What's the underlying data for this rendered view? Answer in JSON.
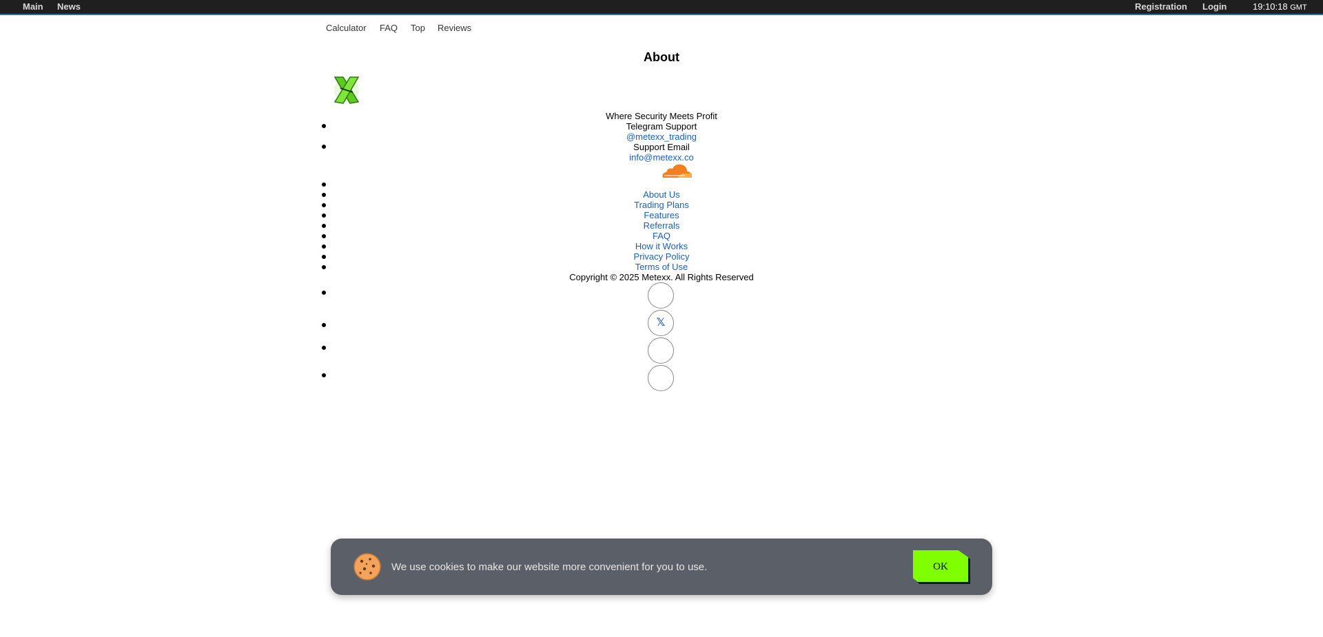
{
  "topbar": {
    "left_links": [
      "Main",
      "News"
    ],
    "right_links": [
      "Registration",
      "Login"
    ],
    "clock": {
      "time": "19:10:18",
      "zone": "GMT"
    }
  },
  "subnav": [
    "Calculator",
    "FAQ",
    "Top",
    "Reviews"
  ],
  "page_title": "About",
  "tagline": "Where Security Meets Profit",
  "contacts": [
    {
      "label": "Telegram Support",
      "value": "@metexx_trading"
    },
    {
      "label": "Support Email",
      "value": "info@metexx.co"
    }
  ],
  "footer_links": [
    "About Us",
    "Trading Plans",
    "Features",
    "Referrals",
    "FAQ",
    "How it Works",
    "Privacy Policy",
    "Terms of Use"
  ],
  "copyright": "Copyright © 2025 Metexx. All Rights Reserved",
  "social": [
    "",
    "𝕏",
    "",
    ""
  ],
  "cookie": {
    "text": "We use cookies to make our website more convenient for you to use.",
    "ok_label": "OK"
  },
  "colors": {
    "accent_green": "#7fff00",
    "link": "#1a5fbf",
    "topbar": "#1f1f1f",
    "cookie_bg": "#5b6068",
    "cloudflare_orange": "#f38020"
  }
}
